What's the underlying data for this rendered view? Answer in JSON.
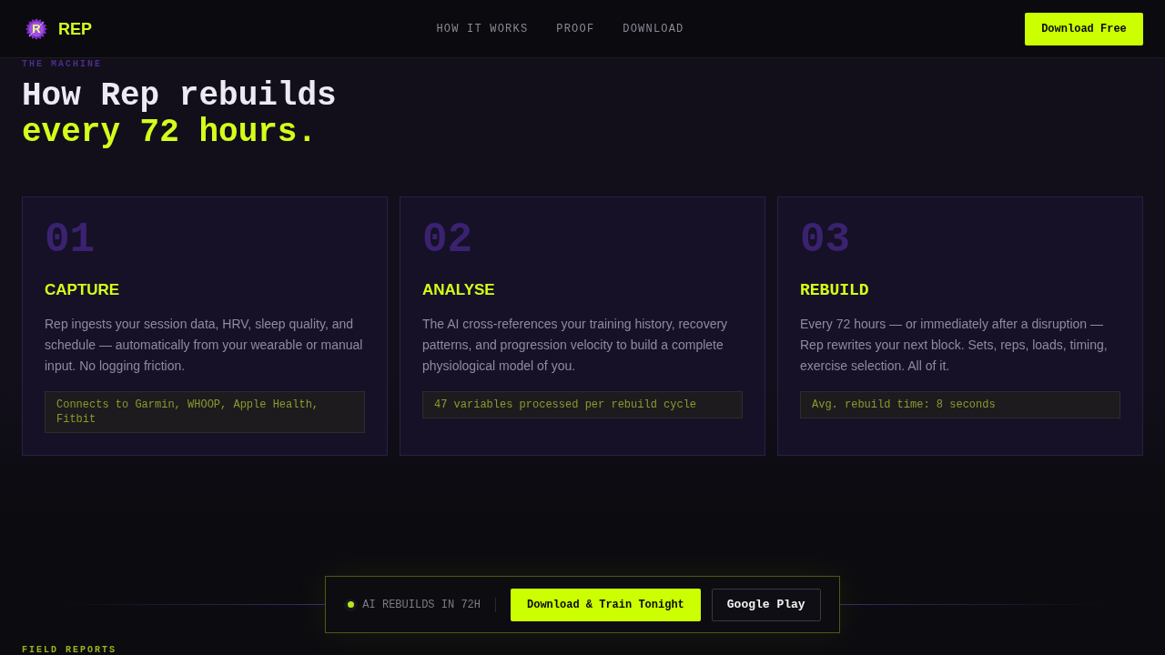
{
  "header": {
    "logo_mark": "R",
    "brand": "REP",
    "nav": [
      {
        "label": "HOW IT WORKS"
      },
      {
        "label": "PROOF"
      },
      {
        "label": "DOWNLOAD"
      }
    ],
    "cta": "Download Free"
  },
  "section": {
    "eyebrow": "THE MACHINE",
    "heading": [
      {
        "text": "How Rep rebuilds",
        "kind": "plain"
      },
      {
        "text": "every 72 hours.",
        "kind": "accent"
      }
    ],
    "steps": [
      {
        "number": "01",
        "title": "CAPTURE",
        "description": "Rep ingests your session data, HRV, sleep quality, and schedule — automatically from your wearable or manual input. No logging friction.",
        "note": "Connects to Garmin, WHOOP, Apple Health, Fitbit"
      },
      {
        "number": "02",
        "title": "ANALYSE",
        "description": "The AI cross-references your training history, recovery patterns, and progression velocity to build a complete physiological model of you.",
        "note": "47 variables processed per rebuild cycle"
      },
      {
        "number": "03",
        "title": "REBUILD",
        "description": "Every 72 hours — or immediately after a disruption — Rep rewrites your next block. Sets, reps, loads, timing, exercise selection. All of it.",
        "note": "Avg. rebuild time: 8 seconds"
      }
    ]
  },
  "cta_bar": {
    "status": "AI REBUILDS IN 72H",
    "buttons": [
      {
        "label": "Download & Train Tonight",
        "kind": "primary"
      },
      {
        "label": "Google Play",
        "kind": "secondary"
      }
    ]
  },
  "next_section": {
    "eyebrow": "FIELD REPORTS"
  }
}
